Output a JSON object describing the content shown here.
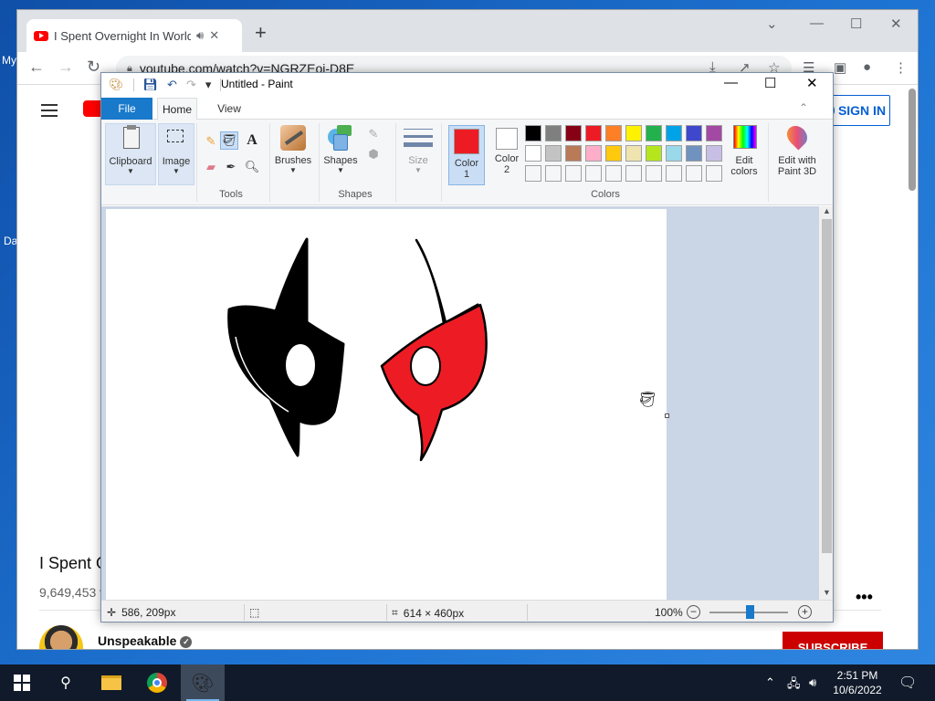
{
  "desktop": {
    "labels": [
      "My",
      "Da"
    ]
  },
  "chrome": {
    "tab_title": "I Spent Overnight In Worlds",
    "tab_audio_icon": "speaker-icon",
    "tab_close": "✕",
    "new_tab": "+",
    "url": "youtube.com/watch?v=NGRZEoi-D8E"
  },
  "youtube": {
    "sign_in": "SIGN IN",
    "video_title": "I Spent O",
    "views": "9,649,453 v",
    "more": "•••",
    "channel_name": "Unspeakable",
    "subscribe": "SUBSCRIBE"
  },
  "paint": {
    "window_title": "Untitled - Paint",
    "tabs": {
      "file": "File",
      "home": "Home",
      "view": "View"
    },
    "clipboard": "Clipboard",
    "image": "Image",
    "tools": "Tools",
    "brushes": "Brushes",
    "shapes": "Shapes",
    "shapes_group": "Shapes",
    "size": "Size",
    "color1_label": "Color\n1",
    "color1_a": "Color",
    "color1_b": "1",
    "color2_a": "Color",
    "color2_b": "2",
    "colors_group": "Colors",
    "edit_colors_a": "Edit",
    "edit_colors_b": "colors",
    "paint3d_a": "Edit with",
    "paint3d_b": "Paint 3D",
    "color1_value": "#ed1c24",
    "color2_value": "#ffffff",
    "palette_row1": [
      "#000000",
      "#7f7f7f",
      "#880015",
      "#ed1c24",
      "#ff7f27",
      "#fff200",
      "#22b14c",
      "#00a2e8",
      "#3f48cc",
      "#a349a4"
    ],
    "palette_row2": [
      "#ffffff",
      "#c3c3c3",
      "#b97a57",
      "#ffaec9",
      "#ffc90e",
      "#efe4b0",
      "#b5e61d",
      "#99d9ea",
      "#7092be",
      "#c8bfe7"
    ],
    "palette_row3": [
      "#f5f6f7",
      "#f5f6f7",
      "#f5f6f7",
      "#f5f6f7",
      "#f5f6f7",
      "#f5f6f7",
      "#f5f6f7",
      "#f5f6f7",
      "#f5f6f7",
      "#f5f6f7"
    ],
    "status": {
      "cursor_pos": "586, 209px",
      "canvas_size": "614 × 460px",
      "zoom": "100%"
    }
  },
  "taskbar": {
    "time": "2:51 PM",
    "date": "10/6/2022"
  }
}
